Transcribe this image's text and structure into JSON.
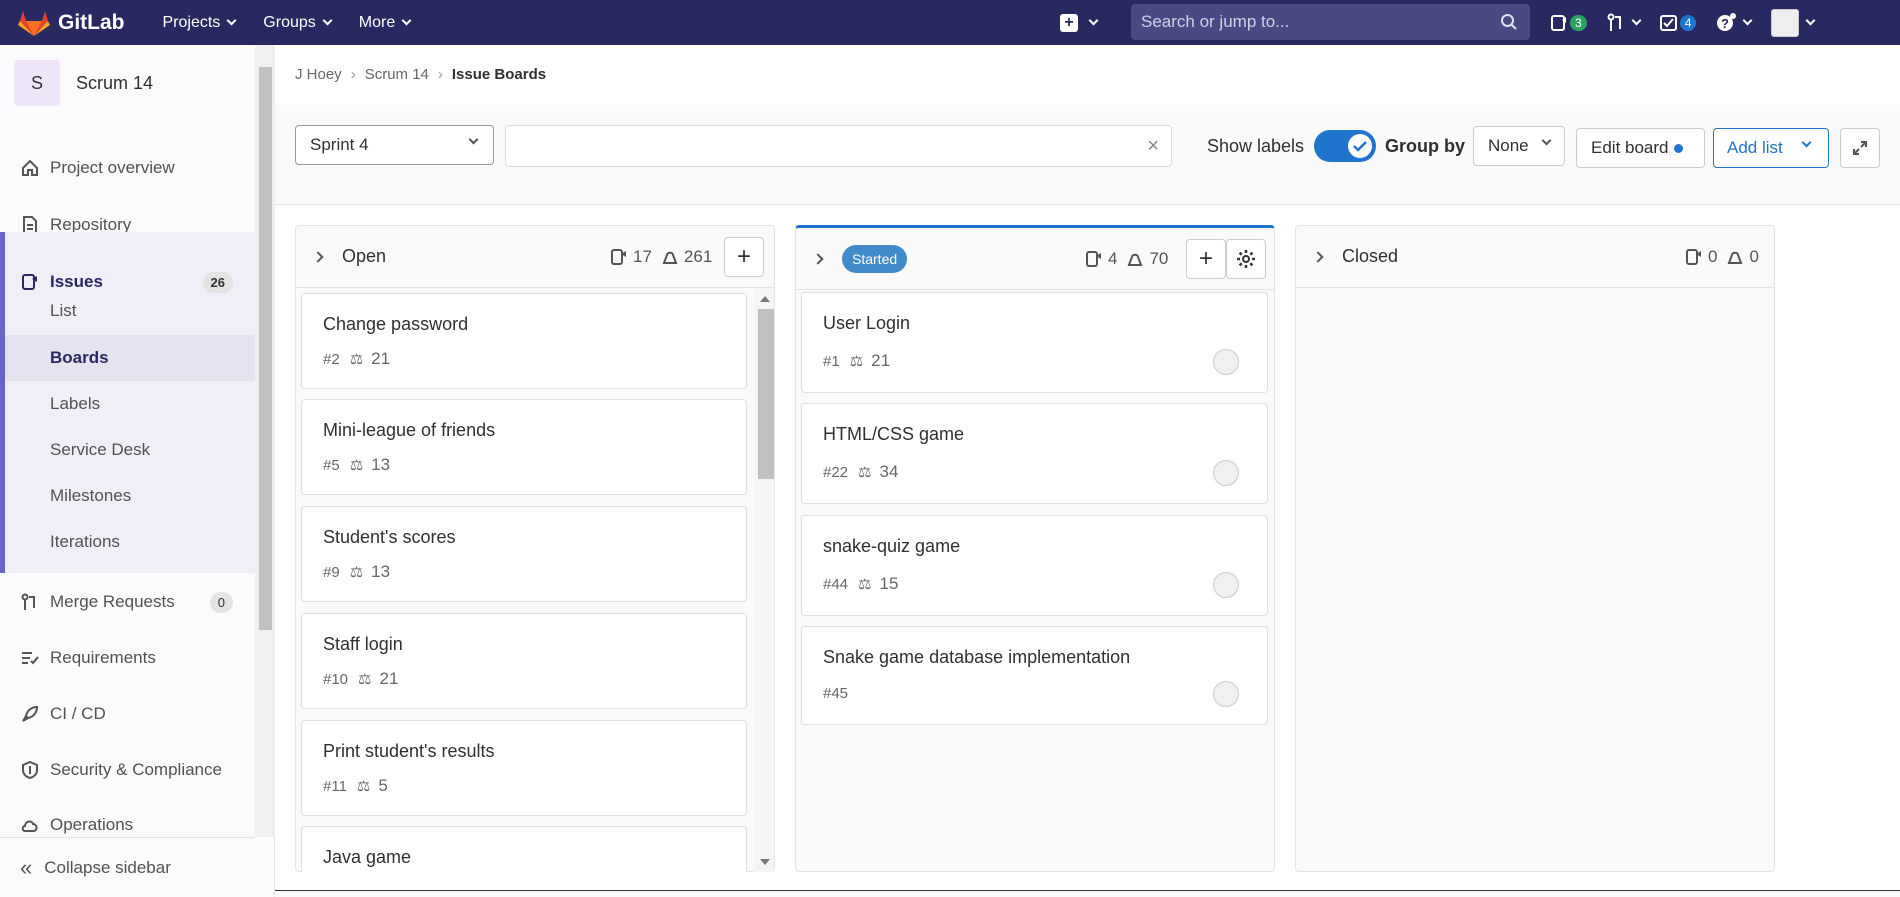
{
  "navbar": {
    "brand": "GitLab",
    "menu": [
      "Projects",
      "Groups",
      "More"
    ],
    "search_placeholder": "Search or jump to...",
    "issues_badge": "3",
    "todos_badge": "4"
  },
  "sidebar": {
    "project_initial": "S",
    "project_name": "Scrum 14",
    "items": {
      "project_overview": "Project overview",
      "repository": "Repository",
      "issues": "Issues",
      "issues_count": "26",
      "merge_requests": "Merge Requests",
      "mr_count": "0",
      "requirements": "Requirements",
      "cicd": "CI / CD",
      "security": "Security & Compliance",
      "operations": "Operations"
    },
    "sub_items": [
      "List",
      "Boards",
      "Labels",
      "Service Desk",
      "Milestones",
      "Iterations"
    ],
    "collapse": "Collapse sidebar"
  },
  "breadcrumb": {
    "user": "J Hoey",
    "project": "Scrum 14",
    "current": "Issue Boards"
  },
  "filters": {
    "sprint": "Sprint 4",
    "show_labels": "Show labels",
    "group_by": "Group by",
    "group_value": "None",
    "edit_board": "Edit board",
    "add_list": "Add list"
  },
  "columns": {
    "open": {
      "title": "Open",
      "issue_count": "17",
      "weight": "261",
      "cards": [
        {
          "title": "Change password",
          "id": "#2",
          "weight": "21"
        },
        {
          "title": "Mini-league of friends",
          "id": "#5",
          "weight": "13"
        },
        {
          "title": "Student's scores",
          "id": "#9",
          "weight": "13"
        },
        {
          "title": "Staff login",
          "id": "#10",
          "weight": "21"
        },
        {
          "title": "Print student's results",
          "id": "#11",
          "weight": "5"
        },
        {
          "title": "Java game",
          "id": "",
          "weight": ""
        }
      ]
    },
    "started": {
      "title": "Started",
      "issue_count": "4",
      "weight": "70",
      "cards": [
        {
          "title": "User Login",
          "id": "#1",
          "weight": "21"
        },
        {
          "title": "HTML/CSS game",
          "id": "#22",
          "weight": "34"
        },
        {
          "title": "snake-quiz game",
          "id": "#44",
          "weight": "15"
        },
        {
          "title": "Snake game database implementation",
          "id": "#45",
          "weight": ""
        }
      ]
    },
    "closed": {
      "title": "Closed",
      "issue_count": "0",
      "weight": "0"
    }
  },
  "colors": {
    "navbar": "#292961",
    "accent": "#1f75cb",
    "started_label": "#428bca",
    "sidebar_active_border": "#6666c4"
  }
}
